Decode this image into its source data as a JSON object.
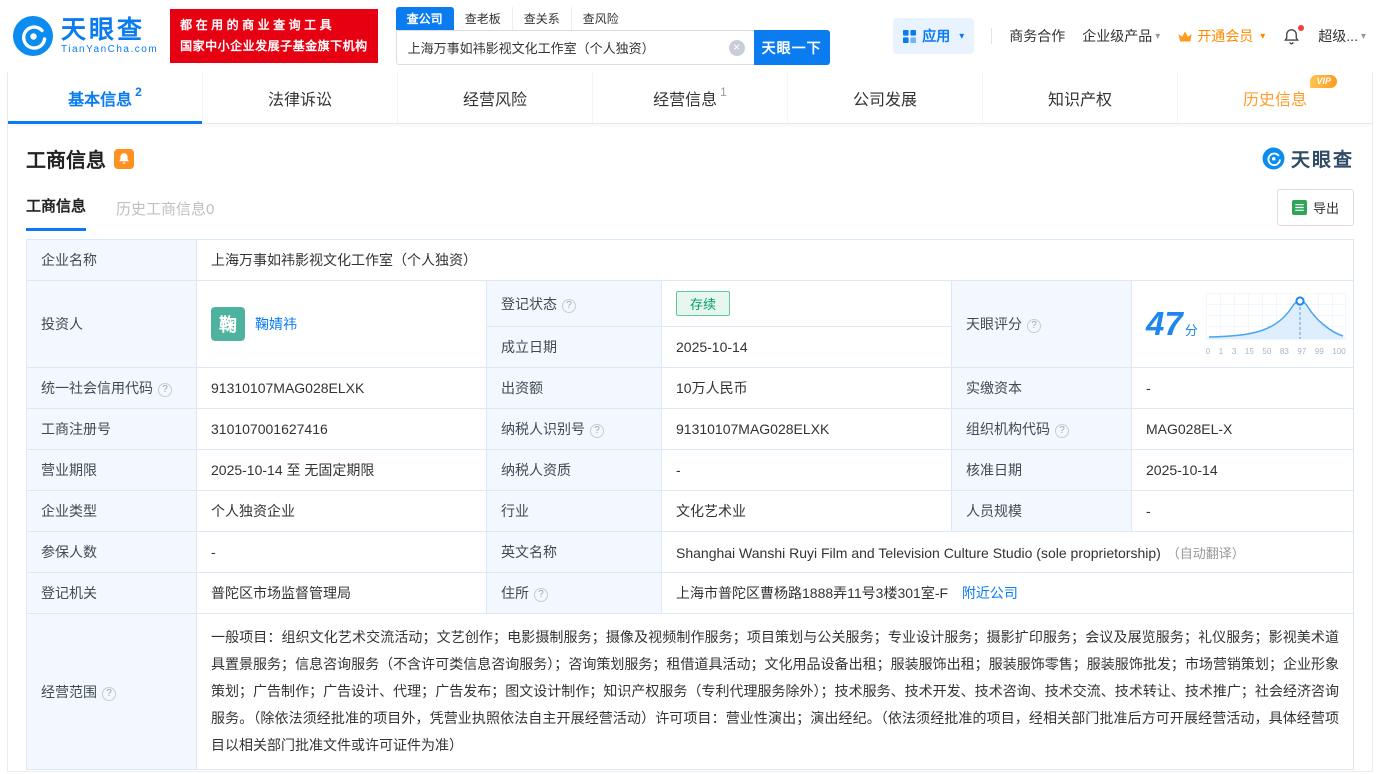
{
  "colors": {
    "brand_blue": "#0a7cf0",
    "banner_red": "#e60012",
    "vip_orange": "#ff8a00",
    "status_green": "#00a064",
    "history_orange": "#ff9d2b"
  },
  "icons": {
    "caret_down": "▾",
    "clear": "×",
    "help": "?"
  },
  "header": {
    "logo_brand": "天眼查",
    "logo_domain": "TianYanCha.com",
    "slogan_line1": "都在用的商业查询工具",
    "slogan_line2": "国家中小企业发展子基金旗下机构",
    "search_tabs": {
      "company": "查公司",
      "boss": "查老板",
      "relation": "查关系",
      "risk": "查风险"
    },
    "search_value": "上海万事如祎影视文化工作室（个人独资）",
    "search_button": "天眼一下",
    "nav_app": "应用",
    "nav_cooperation": "商务合作",
    "nav_enterprise": "企业级产品",
    "nav_vip": "开通会员",
    "nav_user": "超级..."
  },
  "tabs": {
    "basic": {
      "label": "基本信息",
      "count": "2"
    },
    "legal": {
      "label": "法律诉讼"
    },
    "risk": {
      "label": "经营风险"
    },
    "operation": {
      "label": "经营信息",
      "count": "1"
    },
    "development": {
      "label": "公司发展"
    },
    "ip": {
      "label": "知识产权"
    },
    "history": {
      "label": "历史信息",
      "vip": "VIP"
    }
  },
  "section": {
    "title": "工商信息",
    "watermark": "天眼查"
  },
  "subtabs": {
    "current": "工商信息",
    "history": "历史工商信息0",
    "export": "导出"
  },
  "info": {
    "company_name_label": "企业名称",
    "company_name": "上海万事如祎影视文化工作室（个人独资）",
    "investor_label": "投资人",
    "investor_avatar": "鞠",
    "investor_name": "鞠婧祎",
    "reg_status_label": "登记状态",
    "reg_status": "存续",
    "establish_label": "成立日期",
    "establish_date": "2025-10-14",
    "score_label": "天眼评分",
    "score_value": "47",
    "score_unit": "分",
    "score_ticks": [
      "0",
      "1",
      "3",
      "15",
      "50",
      "83",
      "97",
      "99",
      "100"
    ],
    "credit_code_label": "统一社会信用代码",
    "credit_code": "91310107MAG028ELXK",
    "capital_label": "出资额",
    "capital": "10万人民币",
    "paid_capital_label": "实缴资本",
    "paid_capital": "-",
    "reg_number_label": "工商注册号",
    "reg_number": "310107001627416",
    "taxpayer_id_label": "纳税人识别号",
    "taxpayer_id": "91310107MAG028ELXK",
    "org_code_label": "组织机构代码",
    "org_code": "MAG028EL-X",
    "term_label": "营业期限",
    "term": "2025-10-14 至 无固定期限",
    "taxpayer_quality_label": "纳税人资质",
    "taxpayer_quality": "-",
    "approval_label": "核准日期",
    "approval_date": "2025-10-14",
    "type_label": "企业类型",
    "type": "个人独资企业",
    "industry_label": "行业",
    "industry": "文化艺术业",
    "staff_label": "人员规模",
    "staff": "-",
    "insured_label": "参保人数",
    "insured": "-",
    "en_name_label": "英文名称",
    "en_name": "Shanghai Wanshi Ruyi Film and Television Culture Studio (sole proprietorship)",
    "en_name_note": "（自动翻译）",
    "authority_label": "登记机关",
    "authority": "普陀区市场监督管理局",
    "address_label": "住所",
    "address": "上海市普陀区曹杨路1888弄11号3楼301室-F",
    "address_link": "附近公司",
    "scope_label": "经营范围",
    "scope": "一般项目：组织文化艺术交流活动；文艺创作；电影摄制服务；摄像及视频制作服务；项目策划与公关服务；专业设计服务；摄影扩印服务；会议及展览服务；礼仪服务；影视美术道具置景服务；信息咨询服务（不含许可类信息咨询服务）；咨询策划服务；租借道具活动；文化用品设备出租；服装服饰出租；服装服饰零售；服装服饰批发；市场营销策划；企业形象策划；广告制作；广告设计、代理；广告发布；图文设计制作；知识产权服务（专利代理服务除外）；技术服务、技术开发、技术咨询、技术交流、技术转让、技术推广；社会经济咨询服务。（除依法须经批准的项目外，凭营业执照依法自主开展经营活动）许可项目：营业性演出；演出经纪。（依法须经批准的项目，经相关部门批准后方可开展经营活动，具体经营项目以相关部门批准文件或许可证件为准）"
  }
}
